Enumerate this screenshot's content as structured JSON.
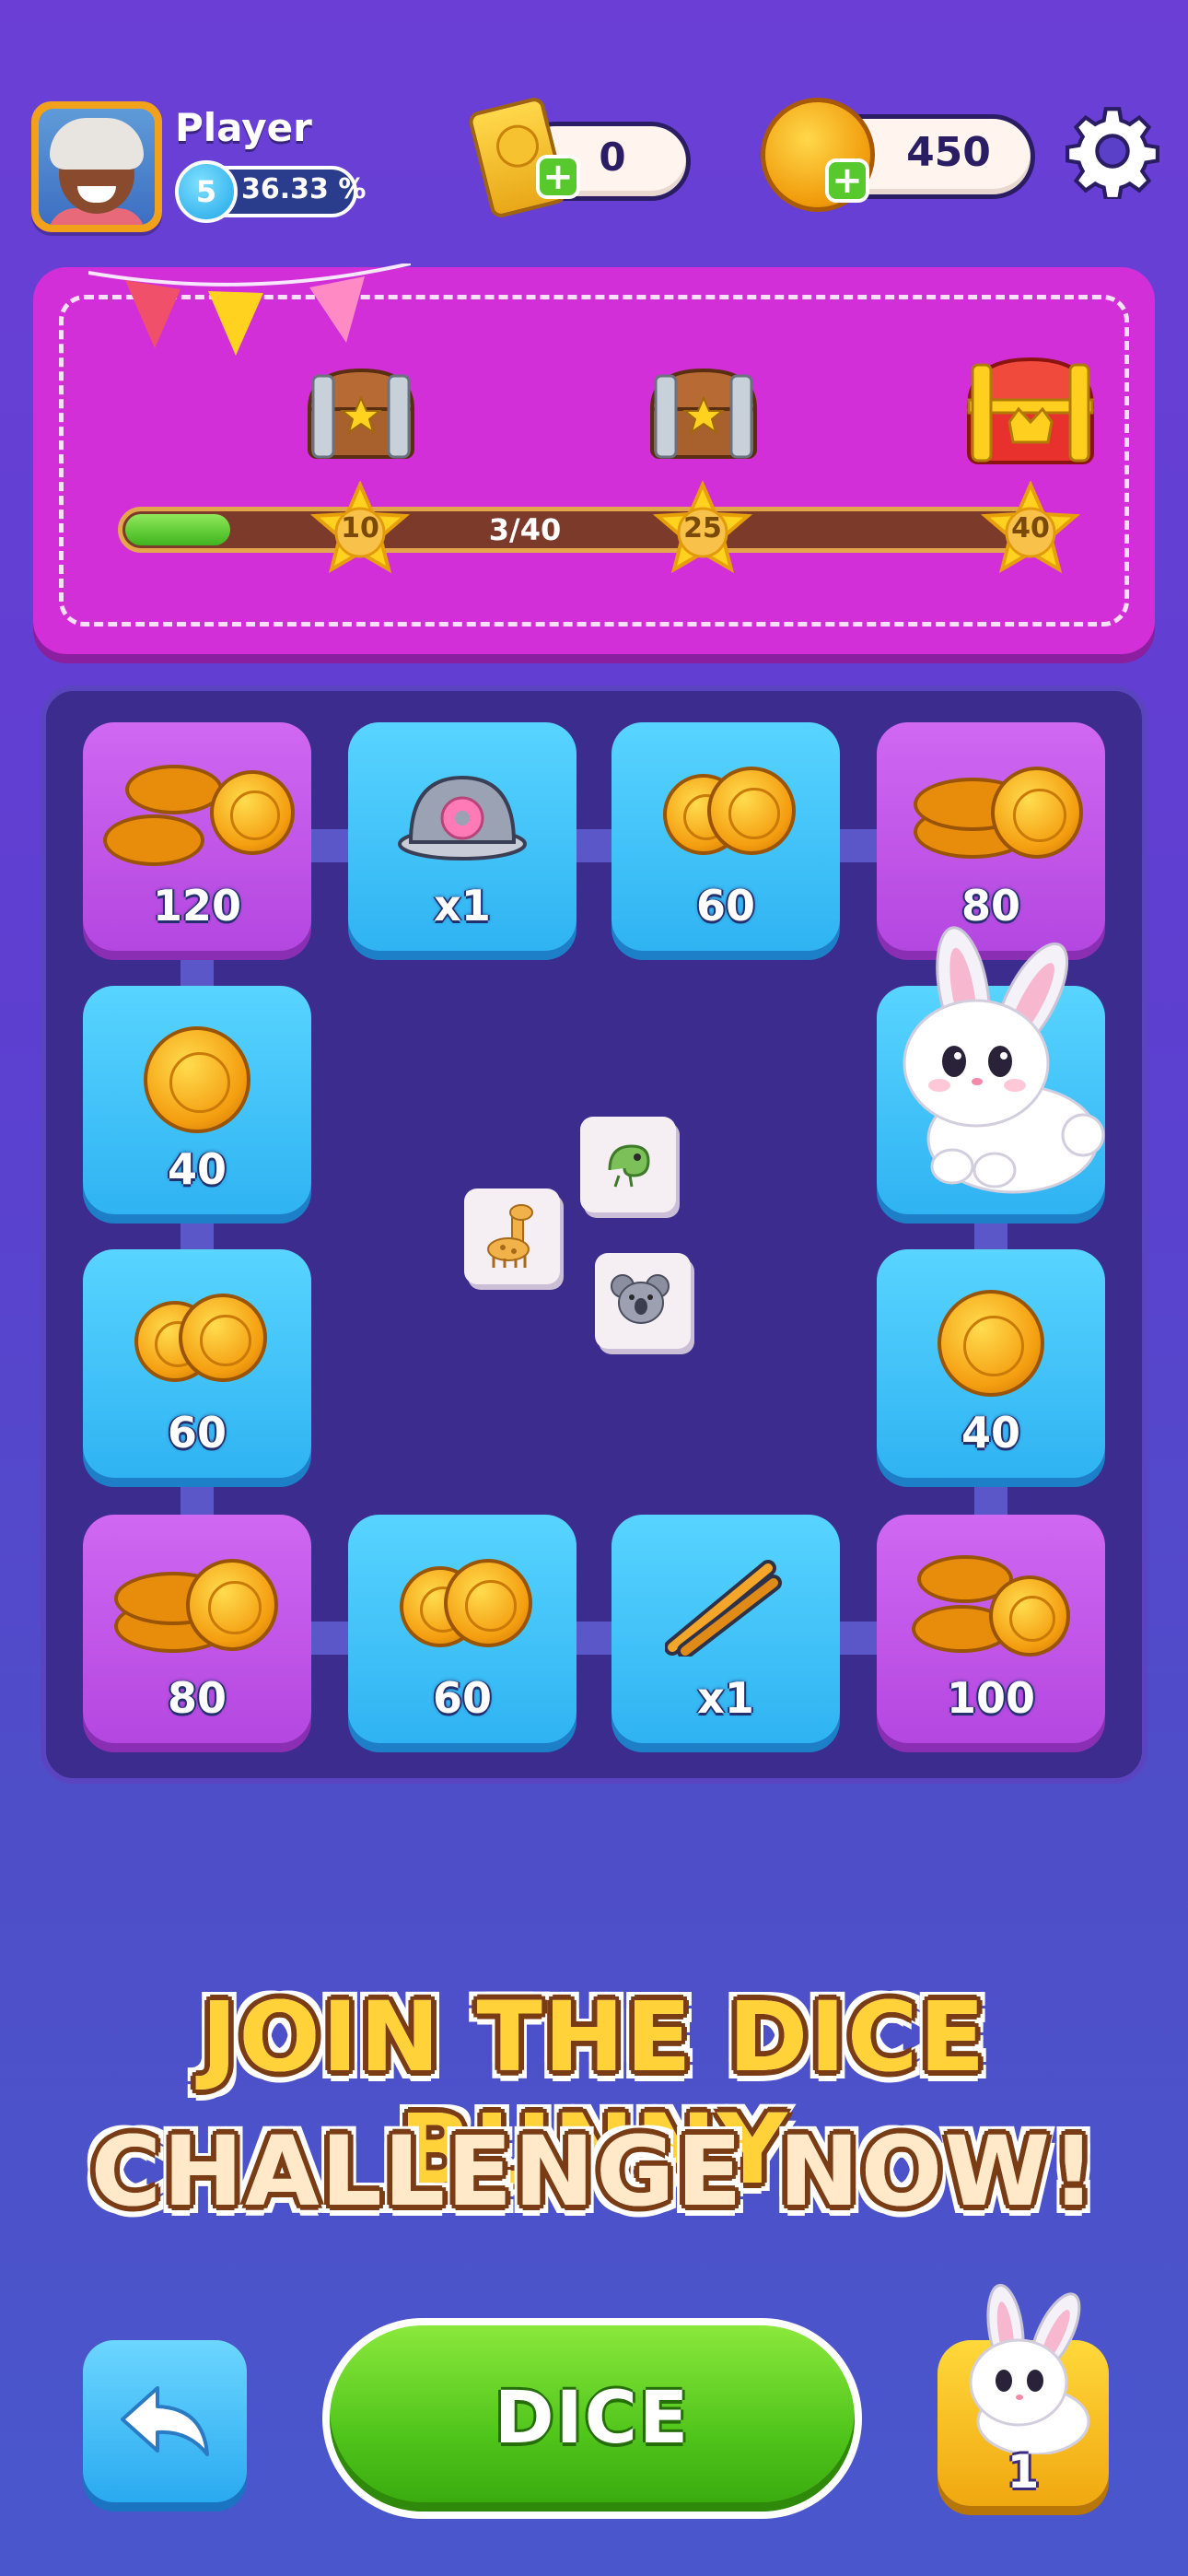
{
  "player": {
    "name": "Player",
    "level": "5",
    "level_progress": "36.33 %"
  },
  "currency": {
    "tickets": "0",
    "coins": "450"
  },
  "progress": {
    "label": "3/40",
    "current": 3,
    "max": 40,
    "milestones": [
      "10",
      "25",
      "40"
    ]
  },
  "board": {
    "tiles": [
      {
        "label": "120",
        "kind": "coin-pile",
        "color": "purple"
      },
      {
        "label": "x1",
        "kind": "donut-dome",
        "color": "blue"
      },
      {
        "label": "60",
        "kind": "coins-two",
        "color": "blue"
      },
      {
        "label": "80",
        "kind": "coin-stack",
        "color": "purple"
      },
      {
        "label": "40",
        "kind": "coin-one",
        "color": "blue"
      },
      {
        "label": "",
        "kind": "bunny",
        "color": "blue"
      },
      {
        "label": "60",
        "kind": "coins-two",
        "color": "blue"
      },
      {
        "label": "40",
        "kind": "coin-one",
        "color": "blue"
      },
      {
        "label": "80",
        "kind": "coin-stack",
        "color": "purple"
      },
      {
        "label": "60",
        "kind": "coins-two",
        "color": "blue"
      },
      {
        "label": "x1",
        "kind": "tongs",
        "color": "blue"
      },
      {
        "label": "100",
        "kind": "coin-pile",
        "color": "purple"
      }
    ],
    "dice_faces": [
      "chameleon-icon",
      "giraffe-icon",
      "koala-icon"
    ]
  },
  "banner": {
    "line1": "JOIN THE DICE BUNNY",
    "line2": "CHALLENGE NOW!"
  },
  "controls": {
    "dice_label": "DICE",
    "bunny_count": "1"
  },
  "colors": {
    "background": "#6b3fd6",
    "panel": "#d22fd9",
    "tile_blue": "#2fb3f2",
    "tile_purple": "#b447e0",
    "dice_button": "#4fc41a"
  }
}
